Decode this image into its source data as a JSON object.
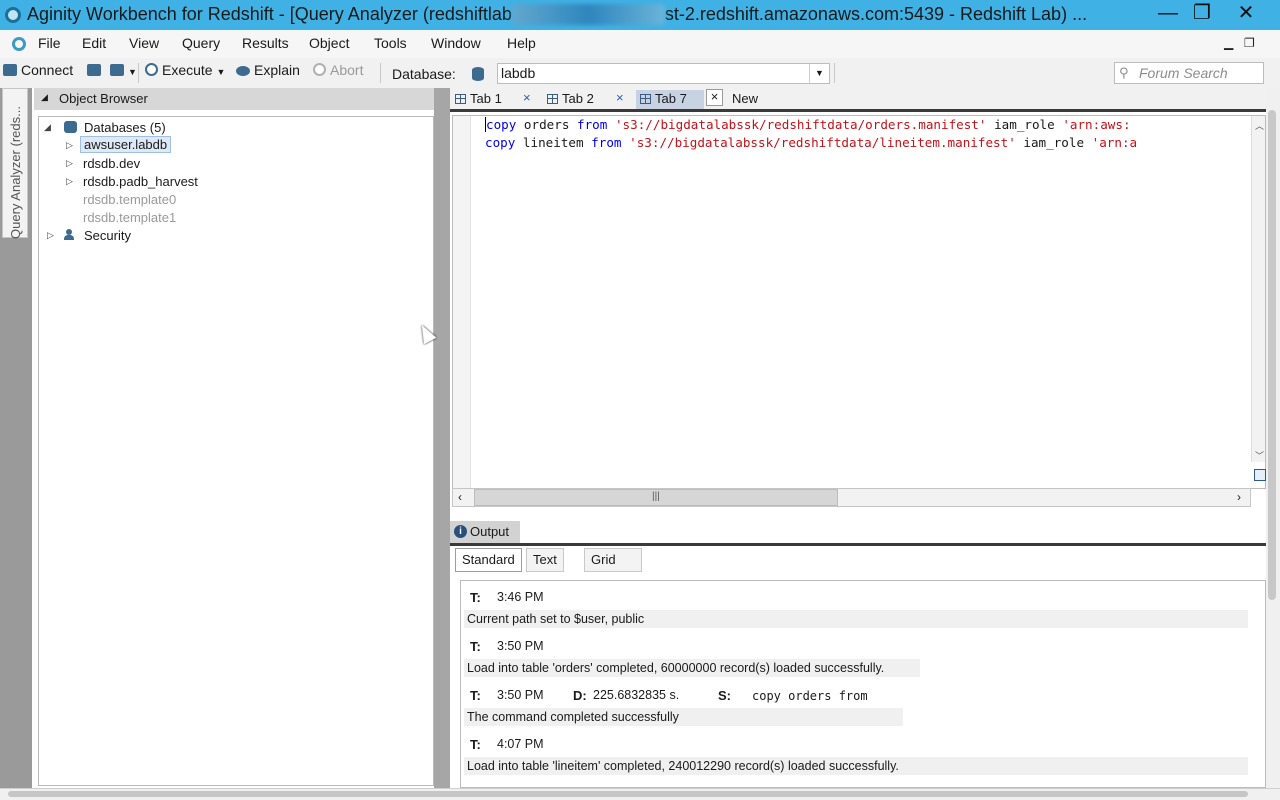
{
  "window": {
    "title_prefix": "Aginity Workbench for Redshift - [Query Analyzer (redshiftlab",
    "title_redacted": "xxxxxxxxxxxxxxxxx",
    "title_suffix": "st-2.redshift.amazonaws.com:5439 - Redshift Lab) ...",
    "minimize": "—",
    "maximize": "❐",
    "close": "✕"
  },
  "menu": {
    "items": [
      "File",
      "Edit",
      "View",
      "Query",
      "Results",
      "Object",
      "Tools",
      "Window",
      "Help"
    ],
    "mdi_minimize": "▁",
    "mdi_restore": "❐"
  },
  "toolbar": {
    "connect": "Connect",
    "execute": "Execute",
    "explain": "Explain",
    "abort": "Abort",
    "database_label": "Database:",
    "database_value": "labdb",
    "forum_search_placeholder": "Forum Search"
  },
  "side_tab": {
    "label": "Query Analyzer (reds..."
  },
  "object_browser": {
    "title": "Object Browser",
    "tree": {
      "root": "Databases (5)",
      "databases": [
        "awsuser.labdb",
        "rdsdb.dev",
        "rdsdb.padb_harvest",
        "rdsdb.template0",
        "rdsdb.template1"
      ],
      "security": "Security"
    }
  },
  "tabs": {
    "items": [
      "Tab 1",
      "Tab 2",
      "Tab 7"
    ],
    "new_label": "New",
    "close_glyph": "×"
  },
  "editor": {
    "lines": [
      {
        "kw1": "copy",
        "table": " orders ",
        "kw2": "from",
        "path": "'s3://bigdatalabssk/redshiftdata/orders.manifest'",
        "rest": " iam_role ",
        "tail": "'arn:aws:"
      },
      {
        "kw1": "copy",
        "table": " lineitem ",
        "kw2": "from",
        "path": "'s3://bigdatalabssk/redshiftdata/lineitem.manifest'",
        "rest": " iam_role ",
        "tail": "'arn:a"
      }
    ]
  },
  "output": {
    "tab_label": "Output",
    "subtabs": [
      "Standard",
      "Text",
      "Grid"
    ],
    "labels": {
      "time": "T:",
      "duration": "D:",
      "statement": "S:"
    },
    "entries": [
      {
        "time": "3:46 PM",
        "message": "Current path set to $user, public"
      },
      {
        "time": "3:50 PM",
        "message": "Load into table 'orders' completed, 60000000 record(s) loaded successfully."
      },
      {
        "time": "3:50 PM",
        "duration": "225.6832835 s.",
        "statement": "copy orders from",
        "message": "The command completed successfully"
      },
      {
        "time": "4:07 PM",
        "message": "Load into table 'lineitem' completed, 240012290 record(s) loaded successfully."
      }
    ]
  }
}
